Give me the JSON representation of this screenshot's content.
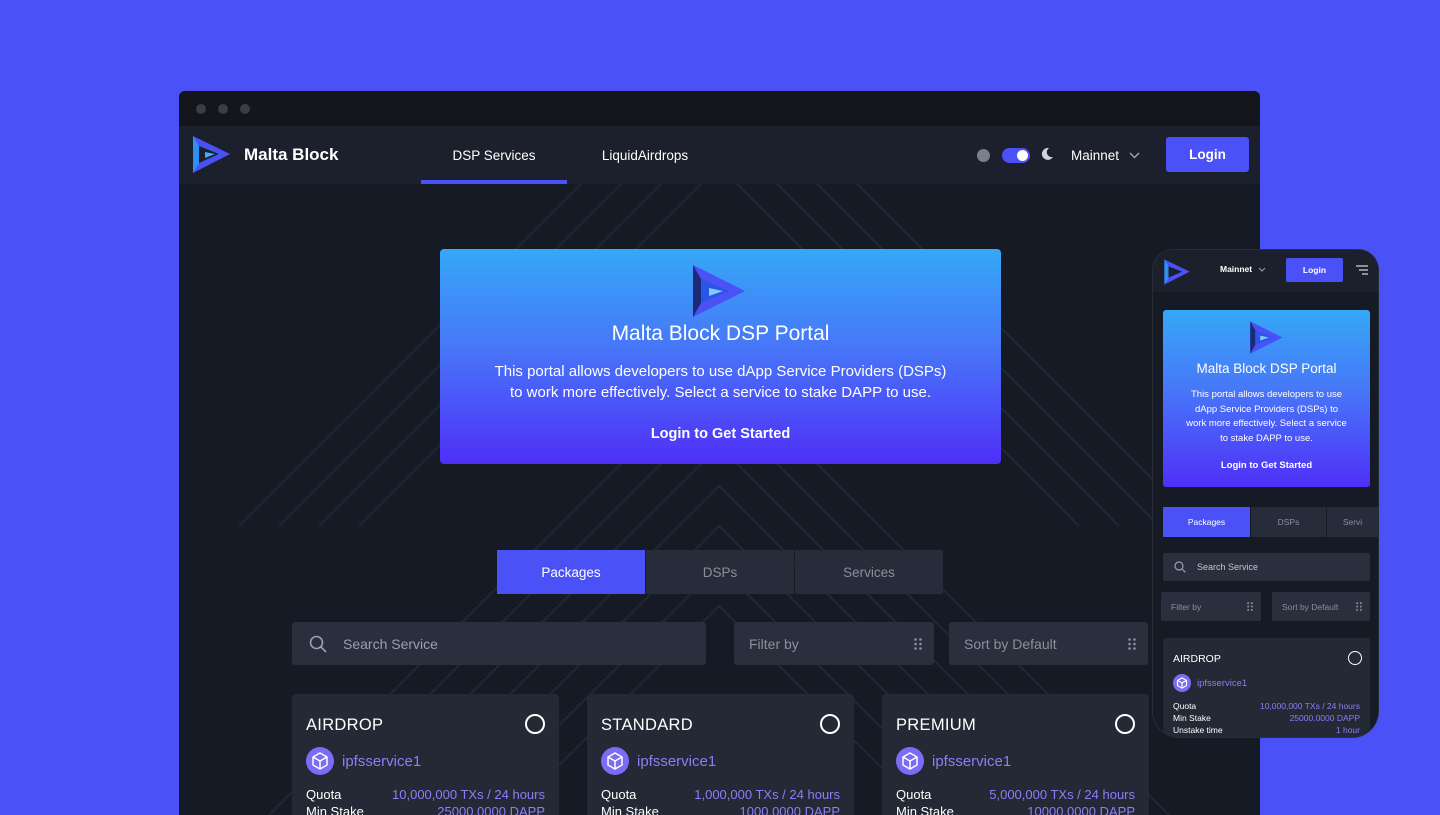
{
  "desktop": {
    "brand": {
      "name": "Malta Block",
      "logo_icon": "malta-block-logo-icon"
    },
    "nav": [
      {
        "label": "DSP Services",
        "active": true
      },
      {
        "label": "LiquidAirdrops",
        "active": false
      }
    ],
    "header": {
      "theme_light_icon": "sun-icon",
      "theme_dark_icon": "moon-icon",
      "network_label": "Mainnet",
      "login_label": "Login"
    },
    "hero": {
      "title": "Malta Block DSP Portal",
      "description_line1": "This portal allows developers to use dApp Service Providers (DSPs)",
      "description_line2": "to work more effectively. Select a service to stake DAPP to use.",
      "cta": "Login to Get Started"
    },
    "tabs": [
      {
        "label": "Packages",
        "active": true
      },
      {
        "label": "DSPs",
        "active": false
      },
      {
        "label": "Services",
        "active": false
      }
    ],
    "search": {
      "placeholder": "Search Service"
    },
    "filter": {
      "label": "Filter by"
    },
    "sort": {
      "label": "Sort by Default"
    },
    "cards": [
      {
        "title": "AIRDROP",
        "service": "ipfsservice1",
        "quota_label": "Quota",
        "quota": "10,000,000 TXs / 24 hours",
        "stake_label": "Min Stake",
        "stake": "25000.0000 DAPP"
      },
      {
        "title": "STANDARD",
        "service": "ipfsservice1",
        "quota_label": "Quota",
        "quota": "1,000,000 TXs / 24 hours",
        "stake_label": "Min Stake",
        "stake": "1000.0000 DAPP"
      },
      {
        "title": "PREMIUM",
        "service": "ipfsservice1",
        "quota_label": "Quota",
        "quota": "5,000,000 TXs / 24 hours",
        "stake_label": "Min Stake",
        "stake": "10000.0000 DAPP"
      }
    ]
  },
  "mobile": {
    "network_label": "Mainnet",
    "login_label": "Login",
    "hero": {
      "title": "Malta Block DSP Portal",
      "description_line1": "This portal allows developers to use",
      "description_line2": "dApp Service Providers (DSPs) to",
      "description_line3": "work more effectively. Select a service",
      "description_line4": "to stake DAPP to use.",
      "cta": "Login to Get Started"
    },
    "tabs": [
      {
        "label": "Packages",
        "active": true
      },
      {
        "label": "DSPs",
        "active": false
      },
      {
        "label": "Servi",
        "active": false
      }
    ],
    "search_placeholder": "Search Service",
    "filter_label": "Filter by",
    "sort_label": "Sort by Default",
    "card": {
      "title": "AIRDROP",
      "service": "ipfsservice1",
      "quota_label": "Quota",
      "quota": "10,000,000 TXs / 24 hours",
      "stake_label": "Min Stake",
      "stake": "25000.0000 DAPP",
      "unstake_label": "Unstake time",
      "unstake": "1 hour"
    }
  },
  "colors": {
    "background": "#4a52f7",
    "accent": "#4a52f7",
    "page": "#161a24",
    "service_text": "#8f7cf8"
  }
}
